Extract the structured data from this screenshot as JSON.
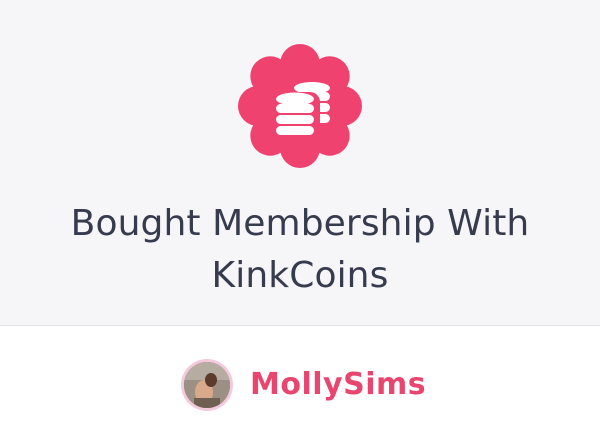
{
  "activity": {
    "icon": "coins-icon",
    "icon_color": "#ef426f",
    "title_line1": "Bought Membership With",
    "title_line2": "KinkCoins"
  },
  "user": {
    "name": "MollySims",
    "name_color": "#e8466e",
    "avatar_ring_color": "#f4c9dc"
  },
  "colors": {
    "top_background": "#f6f6f8",
    "title_text": "#373b4e"
  }
}
